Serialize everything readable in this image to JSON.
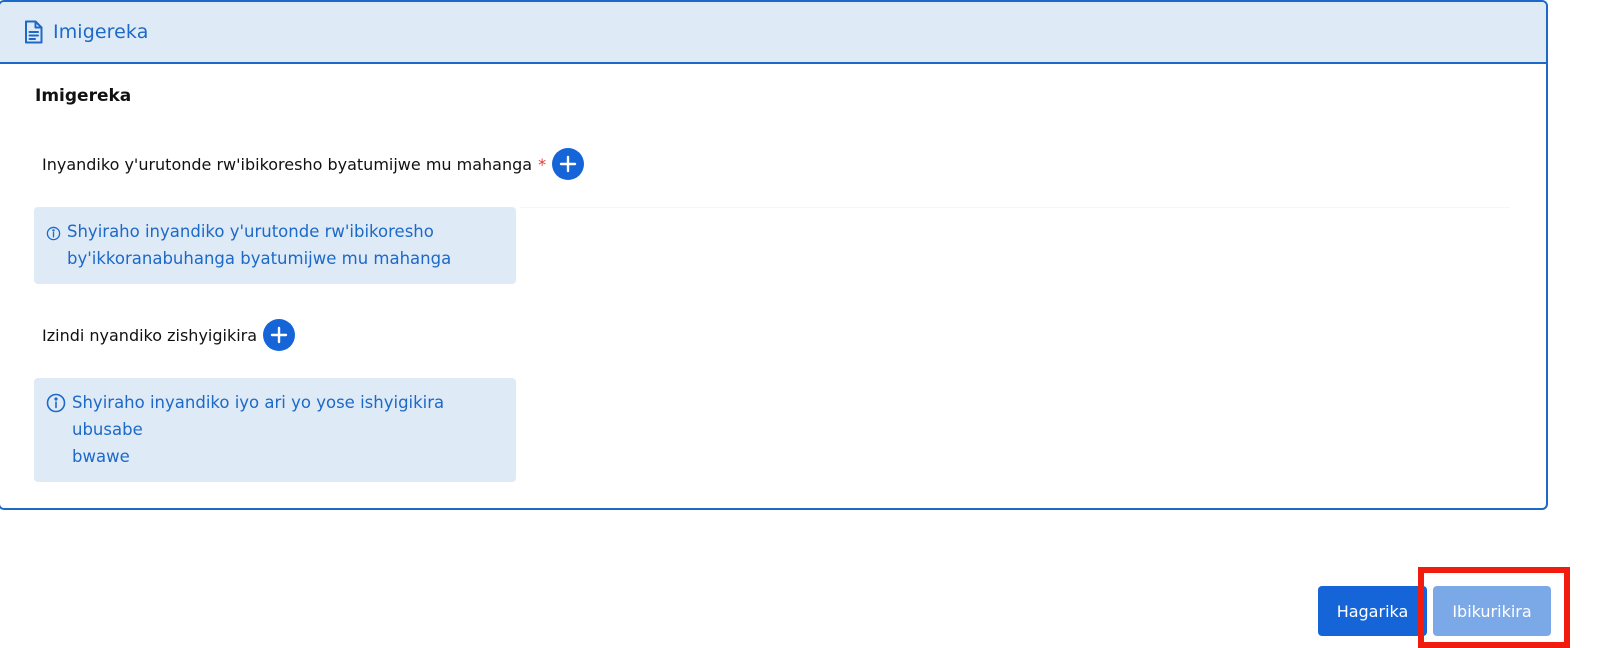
{
  "card": {
    "header_title": "Imigereka",
    "header_icon": "document-icon",
    "section_title": "Imigereka"
  },
  "fields": [
    {
      "label": "Inyandiko y'urutonde rw'ibikoresho byatumijwe mu mahanga",
      "required": true,
      "required_mark": "*",
      "add_icon": "plus-circle-icon",
      "info_icon": "info-icon",
      "info_text_line1": "Shyiraho inyandiko y'urutonde rw'ibikoresho",
      "info_text_line2": "by'ikkoranabuhanga byatumijwe mu mahanga"
    },
    {
      "label": "Izindi nyandiko zishyigikira",
      "required": false,
      "add_icon": "plus-circle-icon",
      "info_icon": "info-icon",
      "info_text_line1": "Shyiraho inyandiko iyo ari yo yose ishyigikira ubusabe",
      "info_text_line2": "bwawe"
    }
  ],
  "actions": {
    "cancel_label": "Hagarika",
    "confirm_label": "Ibikurikira"
  },
  "colors": {
    "accent": "#1565d8",
    "header_bg": "#dfeaf7",
    "border": "#1d69c7",
    "required": "#e53935",
    "confirm_disabled": "#7ba8e6",
    "highlight": "#f21c0e"
  }
}
